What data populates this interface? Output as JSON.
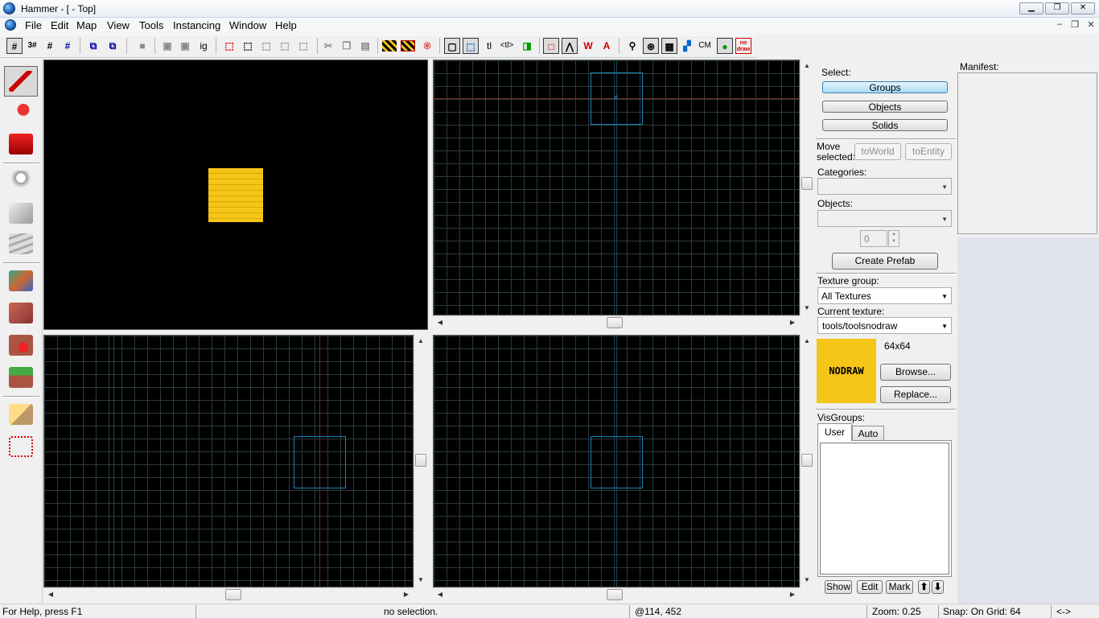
{
  "title": "Hammer - [ - Top]",
  "menu": [
    "File",
    "Edit",
    "Map",
    "View",
    "Tools",
    "Instancing",
    "Window",
    "Help"
  ],
  "toolbar": {
    "tl_label": "tl",
    "tbl_label": "<tl>",
    "cm_label": "CM",
    "nodraw_label": "no draw"
  },
  "right_panel": {
    "select_label": "Select:",
    "groups": "Groups",
    "objects_btn": "Objects",
    "solids": "Solids",
    "move_selected": "Move selected:",
    "to_world": "toWorld",
    "to_entity": "toEntity",
    "categories_label": "Categories:",
    "objects_label": "Objects:",
    "spin_value": "0",
    "create_prefab": "Create Prefab",
    "texture_group_label": "Texture group:",
    "texture_group_value": "All Textures",
    "current_texture_label": "Current texture:",
    "current_texture_value": "tools/toolsnodraw",
    "texture_preview_text": "NODRAW",
    "texture_size": "64x64",
    "browse": "Browse...",
    "replace": "Replace...",
    "visgroups_label": "VisGroups:",
    "tab_user": "User",
    "tab_auto": "Auto",
    "show": "Show",
    "edit": "Edit",
    "mark": "Mark"
  },
  "manifest_label": "Manifest:",
  "status": {
    "help": "For Help, press F1",
    "selection": "no selection.",
    "coords": "@114, 452",
    "zoom": "Zoom: 0.25",
    "snap": "Snap: On Grid: 64",
    "arrows": "<->"
  },
  "colors": {
    "nodraw_yellow": "#f5c518",
    "grid_line": "#2b3b3b",
    "axis_red": "#6e2a16",
    "selection_blue": "#1d82b8"
  }
}
